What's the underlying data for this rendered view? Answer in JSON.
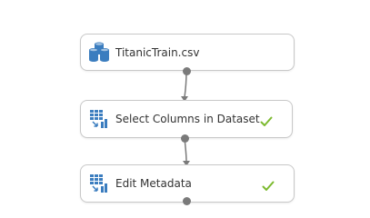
{
  "experiment": {
    "modules": [
      {
        "label": "TitanicTrain.csv",
        "icon": "dataset-icon",
        "status": ""
      },
      {
        "label": "Select Columns in Dataset",
        "icon": "select-columns-icon",
        "status": "completed"
      },
      {
        "label": "Edit Metadata",
        "icon": "edit-metadata-icon",
        "status": "completed"
      }
    ]
  },
  "colors": {
    "icon_blue": "#3b7dbf",
    "check_green": "#7cba2f",
    "connector_gray": "#7a7a7a",
    "border_gray": "#c8c8c8"
  }
}
